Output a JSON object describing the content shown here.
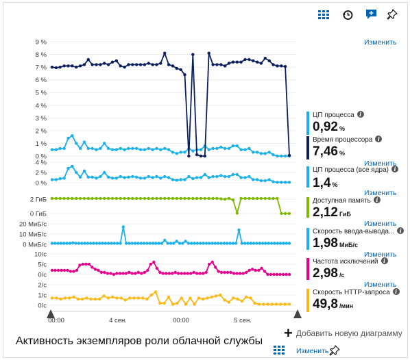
{
  "title": "Активность экземпляров роли облачной службы",
  "add_chart_label": "Добавить новую диаграмму",
  "edit_label": "Изменить",
  "toolbar_icons": [
    "grid-icon",
    "history-icon",
    "feedback-icon",
    "pin-icon"
  ],
  "colors": {
    "cpu": "#1ab1e8",
    "cpu_time": "#0a1f5c",
    "memory": "#7fba00",
    "disk": "#1ab1e8",
    "exceptions": "#e3008c",
    "http": "#fcb814",
    "link": "#0063b1"
  },
  "x_axis": {
    "tick_labels": [
      "00:00",
      "4 сен.",
      "00:00",
      "5 сен."
    ]
  },
  "metrics": [
    {
      "id": "cpu",
      "name": "ЦП процесса",
      "value": "0,92",
      "unit": "%"
    },
    {
      "id": "cpu_time",
      "name": "Время процессора",
      "value": "7,46",
      "unit": "%"
    },
    {
      "id": "cpu_all",
      "name": "ЦП процесса (все ядра)",
      "value": "1,4",
      "unit": "%"
    },
    {
      "id": "memory",
      "name": "Доступная память",
      "value": "2,12",
      "unit": "ГиБ"
    },
    {
      "id": "disk",
      "name": "Скорость ввода-вывода...",
      "value": "1,98",
      "unit": "МиБ/с"
    },
    {
      "id": "exceptions",
      "name": "Частота исключений",
      "value": "2,98",
      "unit": "/с"
    },
    {
      "id": "http",
      "name": "Скорость HTTP-запроса",
      "value": "49,8",
      "unit": "/мин"
    }
  ],
  "chart_data": [
    {
      "type": "line",
      "ylabels": [
        "9 %",
        "8 %",
        "7 %",
        "6 %",
        "5 %",
        "4 %",
        "3 %",
        "2 %",
        "1 %",
        "0 %"
      ],
      "ylim": [
        0,
        9
      ],
      "series": [
        {
          "name": "ЦП процесса",
          "color": "#1ab1e8",
          "values": [
            0.5,
            0.5,
            0.6,
            0.6,
            1.4,
            1.6,
            1.0,
            0.6,
            1.1,
            0.6,
            0.6,
            0.5,
            0.6,
            1.0,
            0.6,
            0.5,
            0.5,
            0.6,
            0.5,
            0.6,
            0.6,
            0.6,
            0.5,
            0.5,
            0.6,
            0.5,
            0.6,
            0.5,
            0.6,
            0.5,
            0.3,
            0.2,
            0.3,
            0.3,
            0.6,
            0.4,
            0.5,
            0.5,
            0.8,
            0.5,
            0.6,
            0.6,
            0.7,
            0.6,
            0.6,
            0.8,
            0.8,
            0.5,
            0.5,
            0.6,
            0.3,
            0.3,
            0.2,
            0.2,
            0.3,
            0.1,
            0.0,
            0.0,
            0.0,
            0.0
          ]
        },
        {
          "name": "Время процессора",
          "color": "#0a1f5c",
          "values": [
            7.0,
            6.95,
            7.0,
            7.1,
            7.1,
            7.1,
            7.0,
            7.1,
            7.2,
            7.6,
            7.2,
            7.2,
            7.2,
            7.3,
            7.2,
            7.4,
            7.5,
            7.1,
            7.0,
            7.2,
            7.2,
            7.2,
            7.2,
            7.2,
            7.3,
            7.2,
            7.2,
            7.3,
            8.1,
            7.2,
            7.1,
            6.9,
            6.8,
            6.4,
            0.0,
            8.0,
            0.1,
            0.0,
            0.0,
            8.1,
            7.2,
            7.2,
            7.2,
            7.1,
            7.3,
            7.4,
            7.4,
            7.4,
            7.6,
            7.6,
            7.5,
            7.4,
            7.3,
            7.7,
            7.5,
            7.2,
            7.1,
            7.1,
            7.05,
            0.05
          ]
        }
      ]
    },
    {
      "type": "line",
      "name": "ЦП процесса (все ядра)",
      "color": "#1ab1e8",
      "ylabels": [
        "4 %",
        "2 %",
        "0 %"
      ],
      "ylim": [
        0,
        4
      ],
      "values": [
        0.6,
        0.6,
        0.8,
        0.9,
        2.8,
        3.2,
        2.0,
        1.1,
        2.3,
        1.1,
        1.1,
        0.9,
        1.2,
        2.0,
        1.1,
        0.9,
        0.9,
        1.2,
        1.0,
        1.1,
        1.2,
        1.1,
        0.9,
        0.9,
        1.2,
        1.0,
        1.2,
        0.9,
        1.2,
        1.0,
        0.6,
        0.5,
        0.6,
        0.6,
        1.2,
        0.8,
        1.0,
        1.0,
        1.6,
        1.0,
        1.2,
        1.2,
        1.4,
        1.2,
        1.2,
        1.6,
        1.6,
        1.0,
        1.0,
        1.2,
        0.6,
        0.6,
        0.4,
        0.4,
        0.6,
        0.2,
        0.1,
        0.1,
        0.1,
        0.1
      ]
    },
    {
      "type": "line",
      "name": "Доступная память",
      "color": "#7fba00",
      "ylabels": [
        "2 ГиБ",
        "0 ГиБ"
      ],
      "ylim": [
        0,
        2
      ],
      "values": [
        2.1,
        2.1,
        2.1,
        2.1,
        2.1,
        2.1,
        2.1,
        2.1,
        2.1,
        2.1,
        2.1,
        2.1,
        2.1,
        2.1,
        2.1,
        2.1,
        2.1,
        2.1,
        2.1,
        2.1,
        2.1,
        2.1,
        2.1,
        2.1,
        2.1,
        2.1,
        2.1,
        2.1,
        2.1,
        2.1,
        2.1,
        2.1,
        2.1,
        2.1,
        2.1,
        2.1,
        2.1,
        2.1,
        2.1,
        2.1,
        2.1,
        2.1,
        2.05,
        2.0,
        2.1,
        1.9,
        0.05,
        2.1,
        2.1,
        2.1,
        2.1,
        2.1,
        2.1,
        2.1,
        2.1,
        2.1,
        2.1,
        0.0,
        0.0,
        0.0
      ]
    },
    {
      "type": "line",
      "name": "Скорость ввода-вывода...",
      "color": "#1ab1e8",
      "ylabels": [
        "20 МиБ/с",
        "10 МиБ/с",
        "0 МиБ/с"
      ],
      "ylim": [
        0,
        20
      ],
      "values": [
        1,
        1,
        1,
        1,
        1,
        1,
        1,
        1.5,
        1,
        1,
        1,
        1,
        1,
        1,
        1,
        1,
        1,
        1,
        1,
        1,
        1,
        1,
        1,
        1,
        17,
        1,
        1,
        1,
        1,
        1,
        1,
        1,
        1,
        1,
        1,
        1,
        1,
        1,
        4,
        1,
        1,
        1,
        3,
        1,
        1,
        3,
        1,
        1,
        1,
        1,
        1,
        1,
        1,
        1,
        1,
        1,
        1,
        1,
        1,
        1,
        1,
        1,
        1,
        14,
        1,
        1,
        1,
        1,
        1,
        1,
        1,
        1,
        1,
        1,
        1,
        1,
        1,
        1,
        1,
        1,
        1
      ]
    },
    {
      "type": "line",
      "name": "Частота исключений",
      "color": "#e3008c",
      "ylabels": [
        "10/с",
        "5/с",
        "0/с"
      ],
      "ylim": [
        0,
        10
      ],
      "values": [
        2,
        2,
        2,
        2,
        2,
        2,
        1.5,
        1.5,
        2,
        4.5,
        5,
        5,
        5,
        3.5,
        2.5,
        2,
        1,
        1,
        0.5,
        0.5,
        0,
        0.5,
        0.5,
        0.5,
        0.5,
        1,
        0.5,
        0.5,
        1,
        0.5,
        1,
        2,
        5,
        6,
        3,
        1,
        0.5,
        0.5,
        0.5,
        0.5,
        1,
        0.5,
        0.5,
        0.5,
        0.5,
        0.5,
        1,
        0.5,
        0.5,
        0.5,
        1,
        5,
        6,
        3.5,
        1.5,
        1,
        1,
        1,
        1,
        0.5,
        0.5,
        0.5,
        0.5,
        1,
        2,
        2.5,
        2,
        2,
        3,
        1.5,
        0,
        0,
        0,
        0,
        0,
        0,
        0,
        0
      ]
    },
    {
      "type": "line",
      "name": "Скорость HTTP-запроса",
      "color": "#fcb814",
      "ylabels": [
        "2/с",
        "1/с",
        "0/с"
      ],
      "ylim": [
        0,
        2
      ],
      "values": [
        0.7,
        0.7,
        0.6,
        0.7,
        0.7,
        0.8,
        0.6,
        0.6,
        0.7,
        0.6,
        0.6,
        0.6,
        0.9,
        0.7,
        0.8,
        0.7,
        0.7,
        0.5,
        0.7,
        0.7,
        0.7,
        0.7,
        0.6,
        1.0,
        1.3,
        0.2,
        0.2,
        0.8,
        0.1,
        0.2,
        0.7,
        0.1,
        0.7,
        0.1,
        0.7,
        0.6,
        0.7,
        0.8,
        0.9,
        1.0,
        0.5,
        0.3,
        0.7,
        0.6,
        0.4,
        0.8,
        0.7,
        0.2,
        0.1,
        0.1,
        0.1,
        0.1,
        0.1,
        0.1,
        0.1,
        0.1
      ]
    }
  ]
}
